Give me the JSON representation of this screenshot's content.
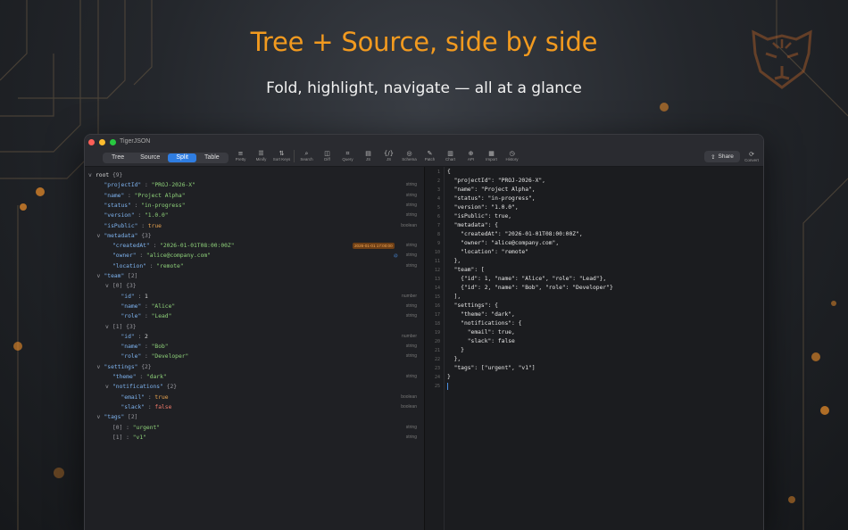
{
  "headline": "Tree + Source, side by side",
  "subline": "Fold, highlight, navigate — all at a glance",
  "logo_icon": "tiger-head-icon",
  "colors": {
    "accent": "#f29a1f",
    "active_segment": "#2f7de1",
    "key": "#7fb4f0",
    "string_value": "#8fd27a",
    "boolean_value": "#f07a6a",
    "date_badge": "#f0a552",
    "link_badge": "#4a8fe0"
  },
  "app": {
    "title": "TigerJSON",
    "view_modes": [
      "Tree",
      "Source",
      "Split",
      "Table"
    ],
    "active_view_mode": "Split",
    "toolbar": [
      {
        "label": "Pretty",
        "icon": "≡"
      },
      {
        "label": "Minify",
        "icon": "☰"
      },
      {
        "label": "Sort Keys",
        "icon": "⇅"
      },
      {
        "label": "Search",
        "icon": "⌕"
      },
      {
        "label": "Diff",
        "icon": "◫"
      },
      {
        "label": "Query",
        "icon": "⌗"
      },
      {
        "label": "JS",
        "icon": "▤"
      },
      {
        "label": "JS",
        "icon": "{/}"
      },
      {
        "label": "Schema",
        "icon": "◎"
      },
      {
        "label": "Patch",
        "icon": "✎"
      },
      {
        "label": "Chart",
        "icon": "▥"
      },
      {
        "label": "API",
        "icon": "⊕"
      },
      {
        "label": "Import",
        "icon": "▦"
      },
      {
        "label": "History",
        "icon": "◷"
      }
    ],
    "share_label": "Share",
    "convert_label": "Convert"
  },
  "tree": [
    {
      "chev": "v",
      "key": "root",
      "count": "{9}",
      "root": true
    },
    {
      "key": "\"projectId\"",
      "value": "\"PROJ-2026-X\"",
      "vtype": "s",
      "type": "string"
    },
    {
      "key": "\"name\"",
      "value": "\"Project Alpha\"",
      "vtype": "s",
      "type": "string"
    },
    {
      "key": "\"status\"",
      "value": "\"in-progress\"",
      "vtype": "s",
      "type": "string"
    },
    {
      "key": "\"version\"",
      "value": "\"1.0.0\"",
      "vtype": "s",
      "type": "string"
    },
    {
      "key": "\"isPublic\"",
      "value": "true",
      "vtype": "bt",
      "type": "boolean"
    },
    {
      "chev": "v",
      "key": "\"metadata\"",
      "count": "{3}"
    },
    {
      "key": "\"createdAt\"",
      "value": "\"2026-01-01T08:00:00Z\"",
      "vtype": "s",
      "type": "string",
      "badge_date": "2026-01-01 17:00:00"
    },
    {
      "key": "\"owner\"",
      "value": "\"alice@company.com\"",
      "vtype": "s",
      "type": "string",
      "badge_ctx": "@"
    },
    {
      "key": "\"location\"",
      "value": "\"remote\"",
      "vtype": "s",
      "type": "string"
    },
    {
      "chev": "v",
      "key": "\"team\"",
      "count": "[2]"
    },
    {
      "chev": "v",
      "key": "[0]",
      "count": "{3}",
      "index": true
    },
    {
      "key": "\"id\"",
      "value": "1",
      "vtype": "n",
      "type": "number"
    },
    {
      "key": "\"name\"",
      "value": "\"Alice\"",
      "vtype": "s",
      "type": "string"
    },
    {
      "key": "\"role\"",
      "value": "\"Lead\"",
      "vtype": "s",
      "type": "string"
    },
    {
      "chev": "v",
      "key": "[1]",
      "count": "{3}",
      "index": true
    },
    {
      "key": "\"id\"",
      "value": "2",
      "vtype": "n",
      "type": "number"
    },
    {
      "key": "\"name\"",
      "value": "\"Bob\"",
      "vtype": "s",
      "type": "string"
    },
    {
      "key": "\"role\"",
      "value": "\"Developer\"",
      "vtype": "s",
      "type": "string"
    },
    {
      "chev": "v",
      "key": "\"settings\"",
      "count": "{2}"
    },
    {
      "key": "\"theme\"",
      "value": "\"dark\"",
      "vtype": "s",
      "type": "string"
    },
    {
      "chev": "v",
      "key": "\"notifications\"",
      "count": "{2}"
    },
    {
      "key": "\"email\"",
      "value": "true",
      "vtype": "bt",
      "type": "boolean"
    },
    {
      "key": "\"slack\"",
      "value": "false",
      "vtype": "b",
      "type": "boolean"
    },
    {
      "chev": "v",
      "key": "\"tags\"",
      "count": "[2]"
    },
    {
      "key": "[0]",
      "value": "\"urgent\"",
      "vtype": "s",
      "type": "string",
      "index": true
    },
    {
      "key": "[1]",
      "value": "\"v1\"",
      "vtype": "s",
      "type": "string",
      "index": true
    }
  ],
  "line_numbers": [
    "1",
    "2",
    "3",
    "4",
    "5",
    "6",
    "7",
    "8",
    "9",
    "10",
    "11",
    "12",
    "13",
    "14",
    "15",
    "16",
    "17",
    "18",
    "19",
    "20",
    "21",
    "22",
    "23",
    "24",
    "25"
  ],
  "source_lines": [
    "{",
    "  \"projectId\": \"PROJ-2026-X\",",
    "  \"name\": \"Project Alpha\",",
    "  \"status\": \"in-progress\",",
    "  \"version\": \"1.0.0\",",
    "  \"isPublic\": true,",
    "  \"metadata\": {",
    "    \"createdAt\": \"2026-01-01T08:00:00Z\",",
    "    \"owner\": \"alice@company.com\",",
    "    \"location\": \"remote\"",
    "  },",
    "  \"team\": [",
    "    {\"id\": 1, \"name\": \"Alice\", \"role\": \"Lead\"},",
    "    {\"id\": 2, \"name\": \"Bob\", \"role\": \"Developer\"}",
    "  ],",
    "  \"settings\": {",
    "    \"theme\": \"dark\",",
    "    \"notifications\": {",
    "      \"email\": true,",
    "      \"slack\": false",
    "    }",
    "  },",
    "  \"tags\": [\"urgent\", \"v1\"]",
    "}"
  ]
}
